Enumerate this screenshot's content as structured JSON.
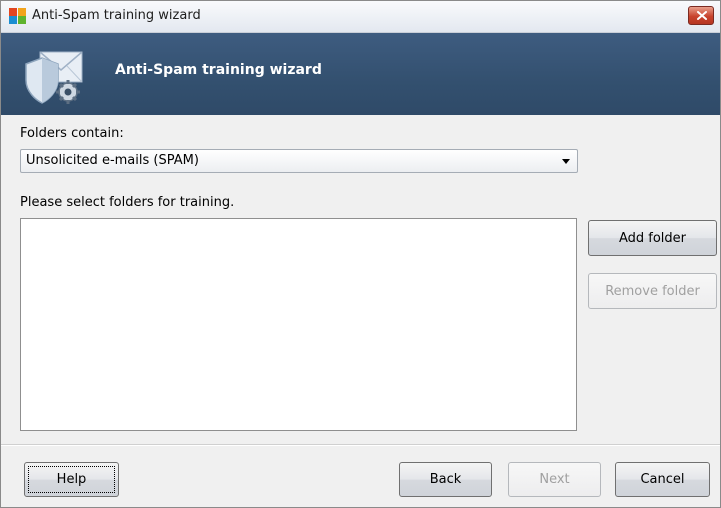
{
  "window": {
    "title": "Anti-Spam training wizard"
  },
  "header": {
    "title": "Anti-Spam training wizard",
    "icon": "shield-envelope-gear-icon"
  },
  "form": {
    "folders_contain_label": "Folders contain:",
    "folders_contain_value": "Unsolicited e-mails (SPAM)",
    "select_folders_label": "Please select folders for training.",
    "folders_list": []
  },
  "side_buttons": {
    "add_folder": "Add folder",
    "remove_folder": "Remove folder"
  },
  "footer": {
    "help": "Help",
    "back": "Back",
    "next": "Next",
    "cancel": "Cancel"
  },
  "colors": {
    "header_band": "#33506f",
    "close_button": "#c8432d"
  }
}
